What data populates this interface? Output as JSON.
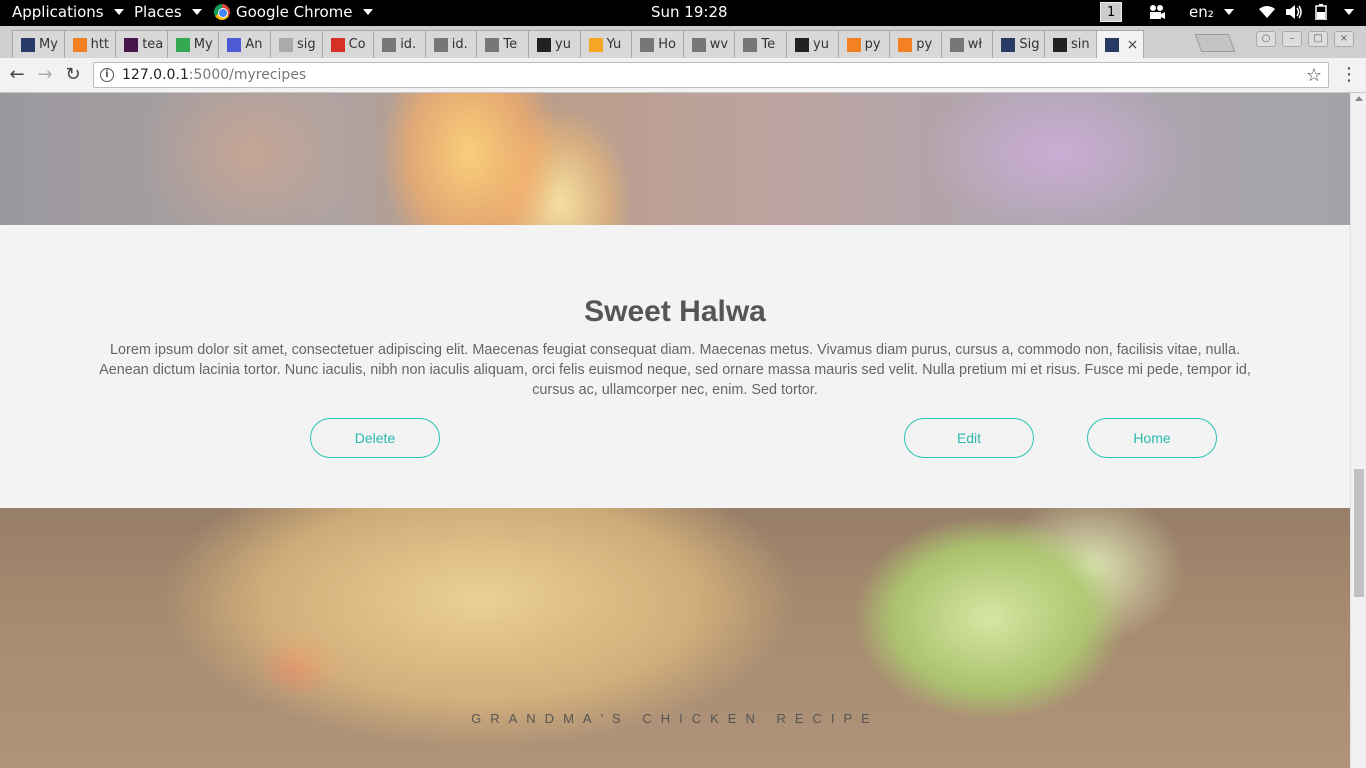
{
  "topbar": {
    "applications": "Applications",
    "places": "Places",
    "active_app": "Google Chrome",
    "clock": "Sun 19:28",
    "workspace": "1",
    "keyboard_layout": "en₂"
  },
  "tabs": [
    {
      "title": "My",
      "icon": "terminal-icon",
      "color": "#2a3a66"
    },
    {
      "title": "htt",
      "icon": "stackoverflow-icon",
      "color": "#f48024"
    },
    {
      "title": "tea",
      "icon": "slack-icon",
      "color": "#4a154b"
    },
    {
      "title": "My",
      "icon": "google-drive-icon",
      "color": "#34a853"
    },
    {
      "title": "An",
      "icon": "docs-icon",
      "color": "#4f5bd5"
    },
    {
      "title": "sig",
      "icon": "h-icon",
      "color": "#aaaaaa"
    },
    {
      "title": "Co",
      "icon": "gmail-icon",
      "color": "#d93025"
    },
    {
      "title": "id.",
      "icon": "page-icon",
      "color": "#777777"
    },
    {
      "title": "id.",
      "icon": "page-icon",
      "color": "#777777"
    },
    {
      "title": "Te",
      "icon": "page-icon",
      "color": "#777777"
    },
    {
      "title": "yu",
      "icon": "github-icon",
      "color": "#222222"
    },
    {
      "title": "Yu",
      "icon": "yuque-icon",
      "color": "#f5a623"
    },
    {
      "title": "Ho",
      "icon": "page-icon",
      "color": "#777777"
    },
    {
      "title": "wv",
      "icon": "page-icon",
      "color": "#777777"
    },
    {
      "title": "Te",
      "icon": "page-icon",
      "color": "#777777"
    },
    {
      "title": "yu",
      "icon": "github-icon",
      "color": "#222222"
    },
    {
      "title": "py",
      "icon": "stackoverflow-icon",
      "color": "#f48024"
    },
    {
      "title": "py",
      "icon": "stackoverflow-icon",
      "color": "#f48024"
    },
    {
      "title": "wł",
      "icon": "page-icon",
      "color": "#777777"
    },
    {
      "title": "Sig",
      "icon": "terminal-icon",
      "color": "#2a3a66"
    },
    {
      "title": "sin",
      "icon": "github-icon",
      "color": "#222222"
    },
    {
      "title": "",
      "icon": "terminal-icon",
      "color": "#2a3a66",
      "active": true
    }
  ],
  "address": {
    "host": "127.0.0.1",
    "rest": ":5000/myrecipes"
  },
  "recipe": {
    "title": "Sweet Halwa",
    "description": "Lorem ipsum dolor sit amet, consectetuer adipiscing elit. Maecenas feugiat consequat diam. Maecenas metus. Vivamus diam purus, cursus a, commodo non, facilisis vitae, nulla. Aenean dictum lacinia tortor. Nunc iaculis, nibh non iaculis aliquam, orci felis euismod neque, sed ornare massa mauris sed velit. Nulla pretium mi et risus. Fusce mi pede, tempor id, cursus ac, ullamcorper nec, enim. Sed tortor.",
    "delete_label": "Delete",
    "edit_label": "Edit",
    "home_label": "Home"
  },
  "next_recipe_caption": "GRANDMA'S CHICKEN RECIPE",
  "colors": {
    "accent": "#2bc4b6",
    "page_bg": "#f3f3f3"
  }
}
